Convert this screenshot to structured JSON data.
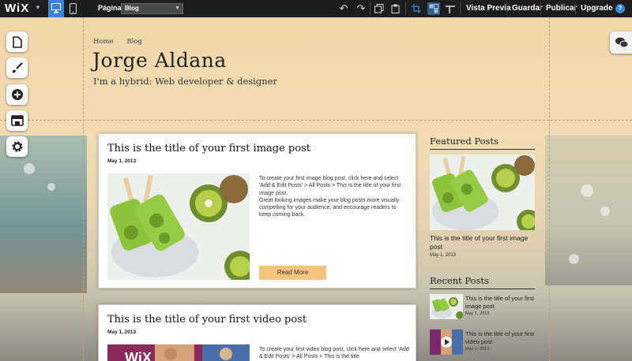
{
  "toolbar": {
    "logo": "WiX",
    "page_label": "Página",
    "page_value": "Blog",
    "preview": "Vista Previa",
    "save": "Guardar",
    "publish": "Publicar",
    "upgrade": "Upgrade",
    "help": "?"
  },
  "site": {
    "breadcrumb": [
      "Home",
      "Blog"
    ],
    "title": "Jorge Aldana",
    "subtitle": "I'm a hybrid: Web developer & designer"
  },
  "posts": [
    {
      "title": "This is the title of your first image post",
      "date": "May 1, 2013",
      "text": "To create your first image blog post, click here and select 'Add & Edit Posts' > All Posts > This is the title of your first image post.\nGreat looking images make your blog posts more visually compelling for your audience, and encourage readers to keep coming back.",
      "read_more": "Read More"
    },
    {
      "title": "This is the title of your first video post",
      "date": "May 1, 2013",
      "text": "To create your first video blog post, click here and select 'Add & Edit Posts' > All Posts > This is the title"
    }
  ],
  "featured": {
    "heading": "Featured Posts",
    "title": "This is the title of your first image post",
    "date": "May 1, 2013"
  },
  "recent": {
    "heading": "Recent Posts",
    "items": [
      {
        "title": "This is the title of your first image post",
        "date": "May 1, 2013"
      },
      {
        "title": "This is the title of your first video post",
        "date": "May 1, 2013"
      }
    ]
  },
  "video_thumb_logo": "WiX",
  "icons": {
    "side": [
      "pages-icon",
      "design-brush-icon",
      "add-icon",
      "app-market-icon",
      "settings-gear-icon"
    ],
    "chat": "chat-bubbles-icon"
  },
  "colors": {
    "toolbar_bg": "#1d1d1d",
    "active_blue": "#3a86d4",
    "read_more_bg": "#f5c57e"
  }
}
